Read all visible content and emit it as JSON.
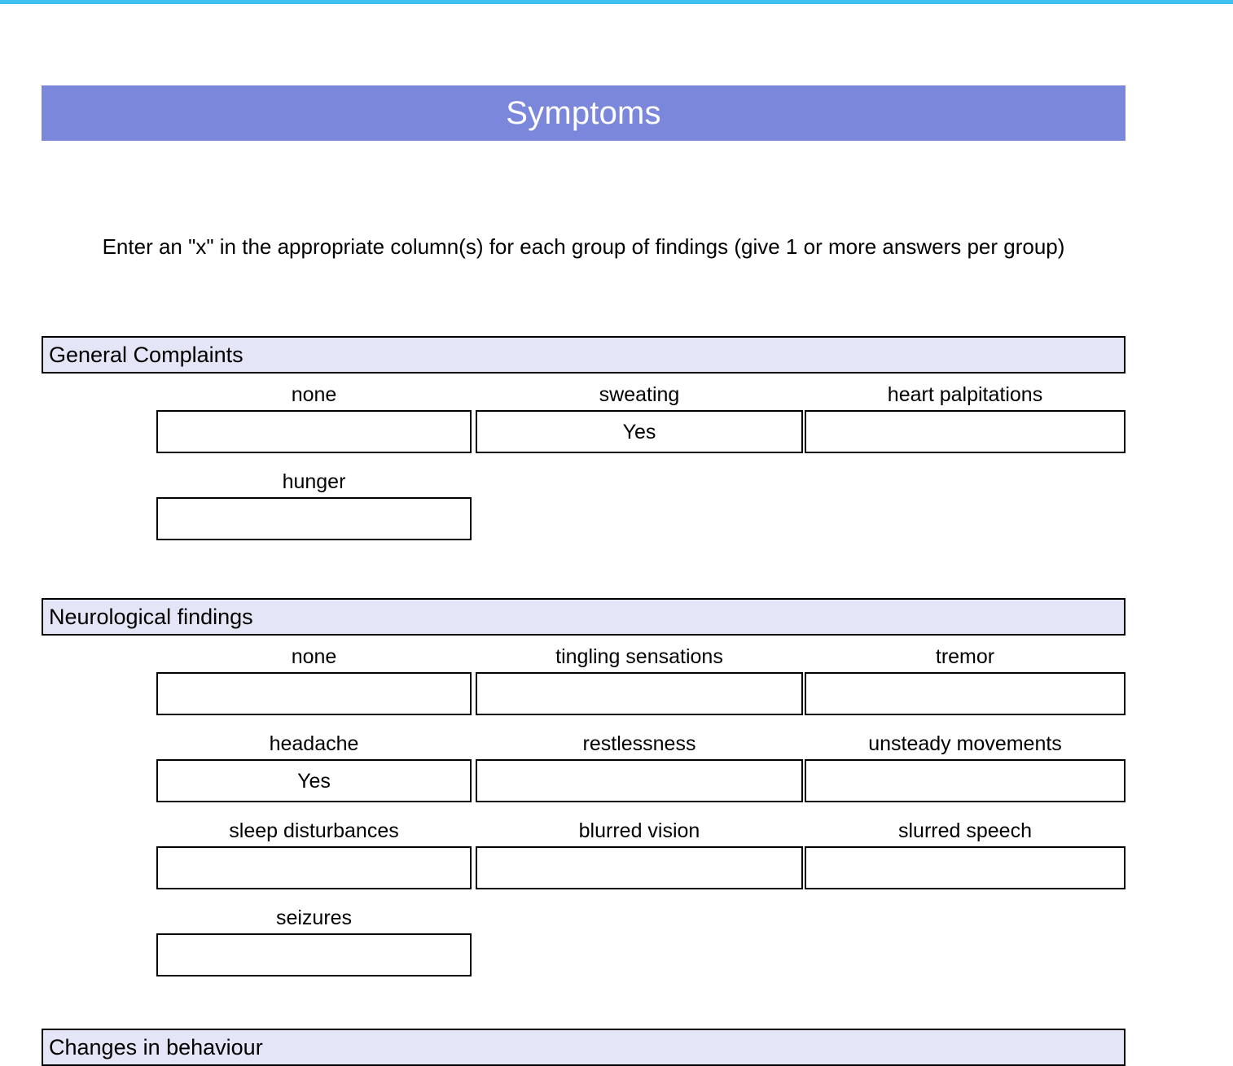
{
  "theme": {
    "accent_bar_color": "#3fc0f0",
    "banner_color": "#7b87db",
    "banner_text_color": "#ffffff",
    "section_header_color": "#e4e5f7",
    "border_color": "#000000"
  },
  "header": {
    "title": "Symptoms"
  },
  "instructions": {
    "text": "Enter an \"x\" in the appropriate column(s) for each group of findings (give 1 or more answers per group)"
  },
  "sections": [
    {
      "title": "General Complaints",
      "rows": [
        [
          {
            "label": "none",
            "value": ""
          },
          {
            "label": "sweating",
            "value": "Yes"
          },
          {
            "label": "heart palpitations",
            "value": ""
          }
        ],
        [
          {
            "label": "hunger",
            "value": ""
          }
        ]
      ]
    },
    {
      "title": "Neurological findings",
      "rows": [
        [
          {
            "label": "none",
            "value": ""
          },
          {
            "label": "tingling sensations",
            "value": ""
          },
          {
            "label": "tremor",
            "value": ""
          }
        ],
        [
          {
            "label": "headache",
            "value": "Yes"
          },
          {
            "label": "restlessness",
            "value": ""
          },
          {
            "label": "unsteady movements",
            "value": ""
          }
        ],
        [
          {
            "label": "sleep disturbances",
            "value": ""
          },
          {
            "label": "blurred vision",
            "value": ""
          },
          {
            "label": "slurred speech",
            "value": ""
          }
        ],
        [
          {
            "label": "seizures",
            "value": ""
          }
        ]
      ]
    },
    {
      "title": "Changes in behaviour",
      "rows": []
    }
  ]
}
